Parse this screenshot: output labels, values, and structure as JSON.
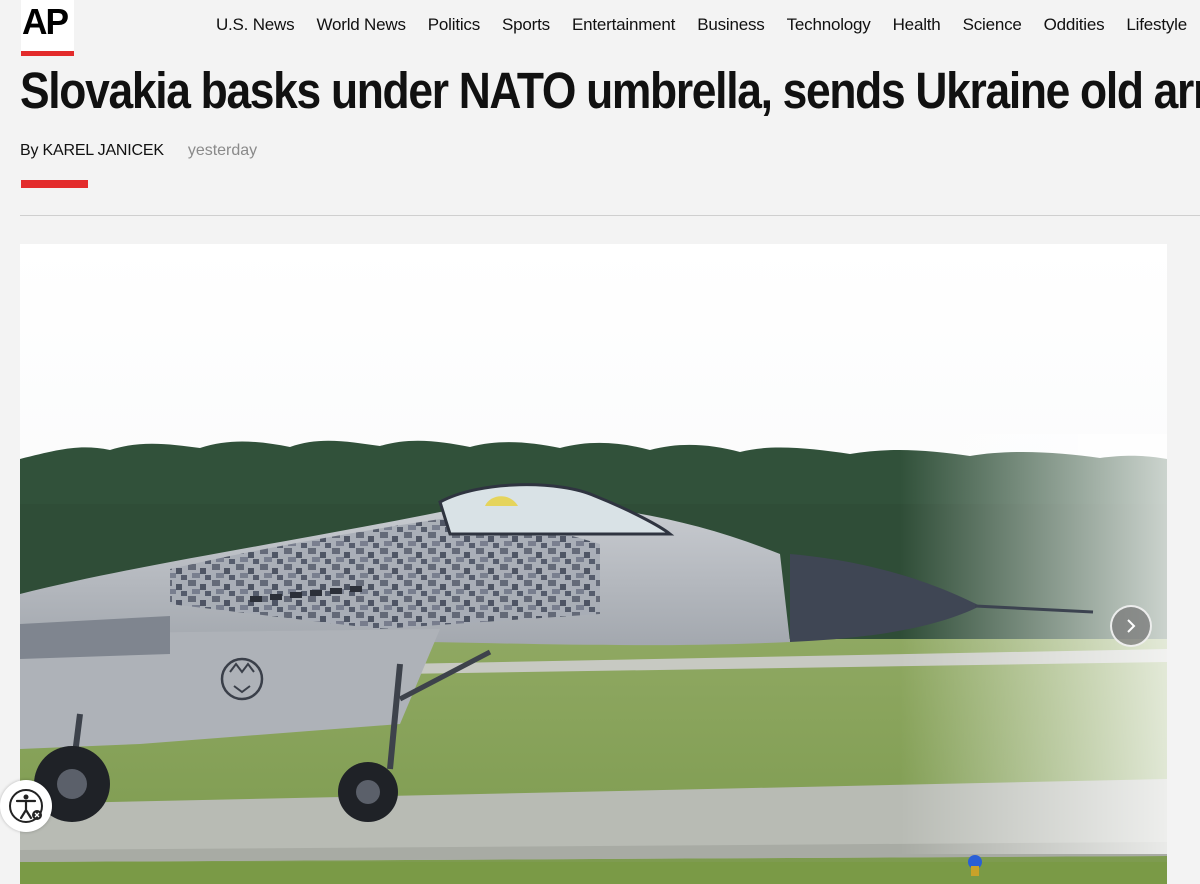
{
  "logo": {
    "text": "AP",
    "accent_color": "#e32b2b"
  },
  "nav": {
    "items": [
      "U.S. News",
      "World News",
      "Politics",
      "Sports",
      "Entertainment",
      "Business",
      "Technology",
      "Health",
      "Science",
      "Oddities",
      "Lifestyle"
    ]
  },
  "article": {
    "headline": "Slovakia basks under NATO umbrella, sends Ukraine old arms",
    "author": "By KAREL JANICEK",
    "timestamp": "yesterday"
  },
  "photo": {
    "subject": "MiG-29 fighter jet with digital camouflage and tiger emblem on runway",
    "next_icon": "chevron-right-icon"
  },
  "accessibility": {
    "icon": "accessibility-icon"
  }
}
